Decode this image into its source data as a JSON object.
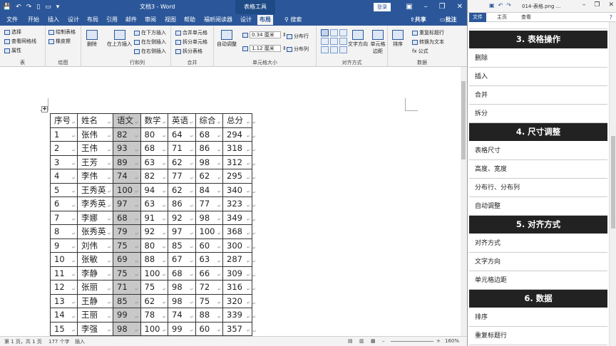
{
  "word": {
    "doc_title": "文档3 - Word",
    "context_tab": "表格工具",
    "login_label": "登录",
    "tabs": [
      {
        "label": "文件",
        "active": false
      },
      {
        "label": "开始",
        "active": false
      },
      {
        "label": "插入",
        "active": false
      },
      {
        "label": "设计",
        "active": false
      },
      {
        "label": "布局",
        "active": false
      },
      {
        "label": "引用",
        "active": false
      },
      {
        "label": "邮件",
        "active": false
      },
      {
        "label": "审阅",
        "active": false
      },
      {
        "label": "视图",
        "active": false
      },
      {
        "label": "帮助",
        "active": false
      },
      {
        "label": "福昕阅读器",
        "active": false
      },
      {
        "label": "设计",
        "active": false
      },
      {
        "label": "布局",
        "active": true
      },
      {
        "label": "搜索",
        "active": false
      }
    ],
    "share_label": "共享",
    "comment_label": "批注",
    "ribbon": {
      "table_group": {
        "label": "表",
        "select": "选择",
        "gridlines": "查看网格线",
        "properties": "属性"
      },
      "draw_group": {
        "label": "绘图",
        "draw_table": "绘制表格",
        "eraser": "橡皮擦"
      },
      "delete_label": "删除",
      "rowcol_group": {
        "label": "行和列",
        "insert_above": "在上方插入",
        "insert_below": "在下方插入",
        "insert_left": "在左侧插入",
        "insert_right": "在右侧插入"
      },
      "merge_group": {
        "label": "合并",
        "merge_cells": "合并单元格",
        "split_cells": "拆分单元格",
        "split_table": "拆分表格"
      },
      "cellsize_group": {
        "label": "单元格大小",
        "autofit": "自动调整",
        "height": "0.34 厘米",
        "width": "1.12 厘米",
        "dist_rows": "分布行",
        "dist_cols": "分布列"
      },
      "align_group": {
        "label": "对齐方式",
        "text_direction": "文字方向",
        "cell_margins": "单元格边距"
      },
      "data_group": {
        "label": "数据",
        "sort": "排序",
        "repeat_header": "重复标题行",
        "convert_text": "转换为文本",
        "formula": "公式"
      }
    },
    "table": {
      "headers": [
        "序号",
        "姓名",
        "语文",
        "数学",
        "英语",
        "综合",
        "总分"
      ],
      "rows": [
        [
          "1",
          "张伟",
          "82",
          "80",
          "64",
          "68",
          "294"
        ],
        [
          "2",
          "王伟",
          "93",
          "68",
          "71",
          "86",
          "318"
        ],
        [
          "3",
          "王芳",
          "89",
          "63",
          "62",
          "98",
          "312"
        ],
        [
          "4",
          "李伟",
          "74",
          "82",
          "77",
          "62",
          "295"
        ],
        [
          "5",
          "王秀英",
          "100",
          "94",
          "62",
          "84",
          "340"
        ],
        [
          "6",
          "李秀英",
          "97",
          "63",
          "86",
          "77",
          "323"
        ],
        [
          "7",
          "李娜",
          "68",
          "91",
          "92",
          "98",
          "349"
        ],
        [
          "8",
          "张秀英",
          "79",
          "92",
          "97",
          "100",
          "368"
        ],
        [
          "9",
          "刘伟",
          "75",
          "80",
          "85",
          "60",
          "300"
        ],
        [
          "10",
          "张敏",
          "69",
          "88",
          "67",
          "63",
          "287"
        ],
        [
          "11",
          "李静",
          "75",
          "100",
          "68",
          "66",
          "309"
        ],
        [
          "12",
          "张丽",
          "71",
          "75",
          "98",
          "72",
          "316"
        ],
        [
          "13",
          "王静",
          "85",
          "62",
          "98",
          "75",
          "320"
        ],
        [
          "14",
          "王丽",
          "99",
          "78",
          "74",
          "88",
          "339"
        ],
        [
          "15",
          "李强",
          "98",
          "100",
          "99",
          "60",
          "357"
        ]
      ]
    },
    "status": {
      "page": "第 1 页，共 1 页",
      "words": "177 个字",
      "mode": "插入",
      "zoom": "160%"
    }
  },
  "panel": {
    "filename": "014-表格.png ...",
    "tabs": [
      {
        "label": "文件",
        "active": true
      },
      {
        "label": "主页",
        "active": false
      },
      {
        "label": "查看",
        "active": false
      }
    ],
    "sections": [
      {
        "header": "3. 表格操作",
        "items": [
          "删除",
          "插入",
          "合并",
          "拆分"
        ]
      },
      {
        "header": "4. 尺寸调整",
        "items": [
          "表格尺寸",
          "高度、宽度",
          "分布行、分布列",
          "自动调整"
        ]
      },
      {
        "header": "5. 对齐方式",
        "items": [
          "对齐方式",
          "文字方向",
          "单元格边距"
        ]
      },
      {
        "header": "6. 数据",
        "items": [
          "排序",
          "重复标题行"
        ]
      }
    ]
  },
  "colors": {
    "word_blue": "#2b579a",
    "highlight_gray": "#c8c8c8",
    "panel_header": "#222222"
  }
}
